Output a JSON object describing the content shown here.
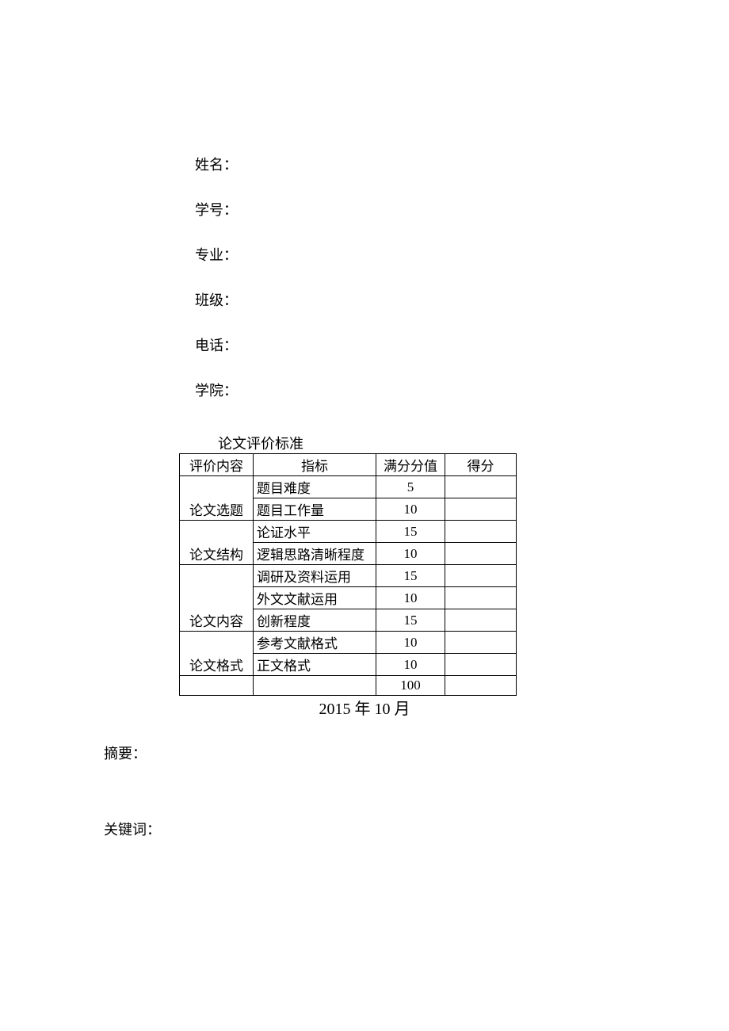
{
  "info": {
    "name_label": "姓名：",
    "id_label": "学号：",
    "major_label": "专业：",
    "class_label": "班级：",
    "phone_label": "电话：",
    "college_label": "学院："
  },
  "table": {
    "title": "论文评价标准",
    "headers": {
      "category": "评价内容",
      "indicator": "指标",
      "max_score": "满分分值",
      "score": "得分"
    },
    "categories": [
      {
        "name": "论文选题",
        "rowspan": 2,
        "rows": [
          {
            "indicator": "题目难度",
            "max": "5",
            "score": ""
          },
          {
            "indicator": "题目工作量",
            "max": "10",
            "score": ""
          }
        ]
      },
      {
        "name": "论文结构",
        "rowspan": 2,
        "rows": [
          {
            "indicator": "论证水平",
            "max": "15",
            "score": ""
          },
          {
            "indicator": "逻辑思路清晰程度",
            "max": "10",
            "score": ""
          }
        ]
      },
      {
        "name": "论文内容",
        "rowspan": 3,
        "rows": [
          {
            "indicator": "调研及资料运用",
            "max": "15",
            "score": ""
          },
          {
            "indicator": "外文文献运用",
            "max": "10",
            "score": ""
          },
          {
            "indicator": "创新程度",
            "max": "15",
            "score": ""
          }
        ]
      },
      {
        "name": "论文格式",
        "rowspan": 2,
        "rows": [
          {
            "indicator": "参考文献格式",
            "max": "10",
            "score": ""
          },
          {
            "indicator": "正文格式",
            "max": "10",
            "score": ""
          }
        ]
      }
    ],
    "total": {
      "category": "",
      "indicator": "",
      "max": "100",
      "score": ""
    }
  },
  "date": "2015 年 10 月",
  "abstract_label": "摘要：",
  "keywords_label": "关键词："
}
